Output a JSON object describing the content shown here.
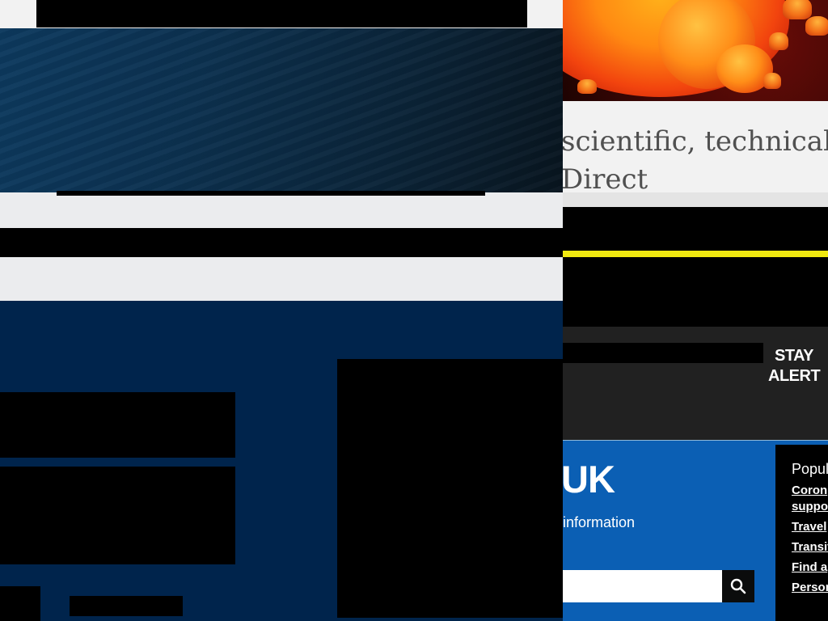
{
  "sciencedirect": {
    "line1": "scientific, technical, an",
    "line2": "Direct"
  },
  "stay_alert": {
    "line1": "STAY",
    "line2": "ALERT"
  },
  "govuk": {
    "title": "UK",
    "subtitle": "information",
    "search": {
      "value": "",
      "placeholder": ""
    },
    "search_icon": "search-icon"
  },
  "popular": {
    "title": "Popul",
    "links": [
      {
        "label_1": "Coron",
        "label_2": "suppo"
      },
      {
        "label_1": "Travel"
      },
      {
        "label_1": "Transit"
      },
      {
        "label_1": "Find a"
      },
      {
        "label_1": "Person"
      }
    ]
  },
  "colors": {
    "navy": "#00244c",
    "banner_blue": "#0c3150",
    "alert_yellow": "#f0e810",
    "stay_panel": "#212121",
    "gov_blue": "#0b5fb4",
    "popular_bg": "#000000"
  }
}
